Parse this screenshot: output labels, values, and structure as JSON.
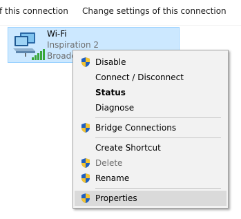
{
  "toolbar": {
    "left_label": "f this connection",
    "right_label": "Change settings of this connection"
  },
  "adapter": {
    "name": "Wi-Fi",
    "line2": "Inspiration  2",
    "line3": "Broado",
    "icon": "wifi-adapter-icon",
    "signal_bars": 5
  },
  "menu": {
    "items": [
      {
        "label": "Disable",
        "icon": "shield-icon"
      },
      {
        "label": "Connect / Disconnect"
      },
      {
        "label": "Status",
        "bold": true
      },
      {
        "label": "Diagnose"
      },
      {
        "label": "Bridge Connections",
        "icon": "shield-icon"
      },
      {
        "label": "Create Shortcut"
      },
      {
        "label": "Delete",
        "icon": "shield-icon",
        "disabled": true
      },
      {
        "label": "Rename",
        "icon": "shield-icon"
      },
      {
        "label": "Properties",
        "icon": "shield-icon",
        "highlighted": true
      }
    ]
  },
  "colors": {
    "selection_bg": "#cce8ff",
    "selection_border": "#99d1ff",
    "menu_bg": "#f2f2f2",
    "menu_hover": "#dadada",
    "disabled_text": "#6d6d6d"
  }
}
